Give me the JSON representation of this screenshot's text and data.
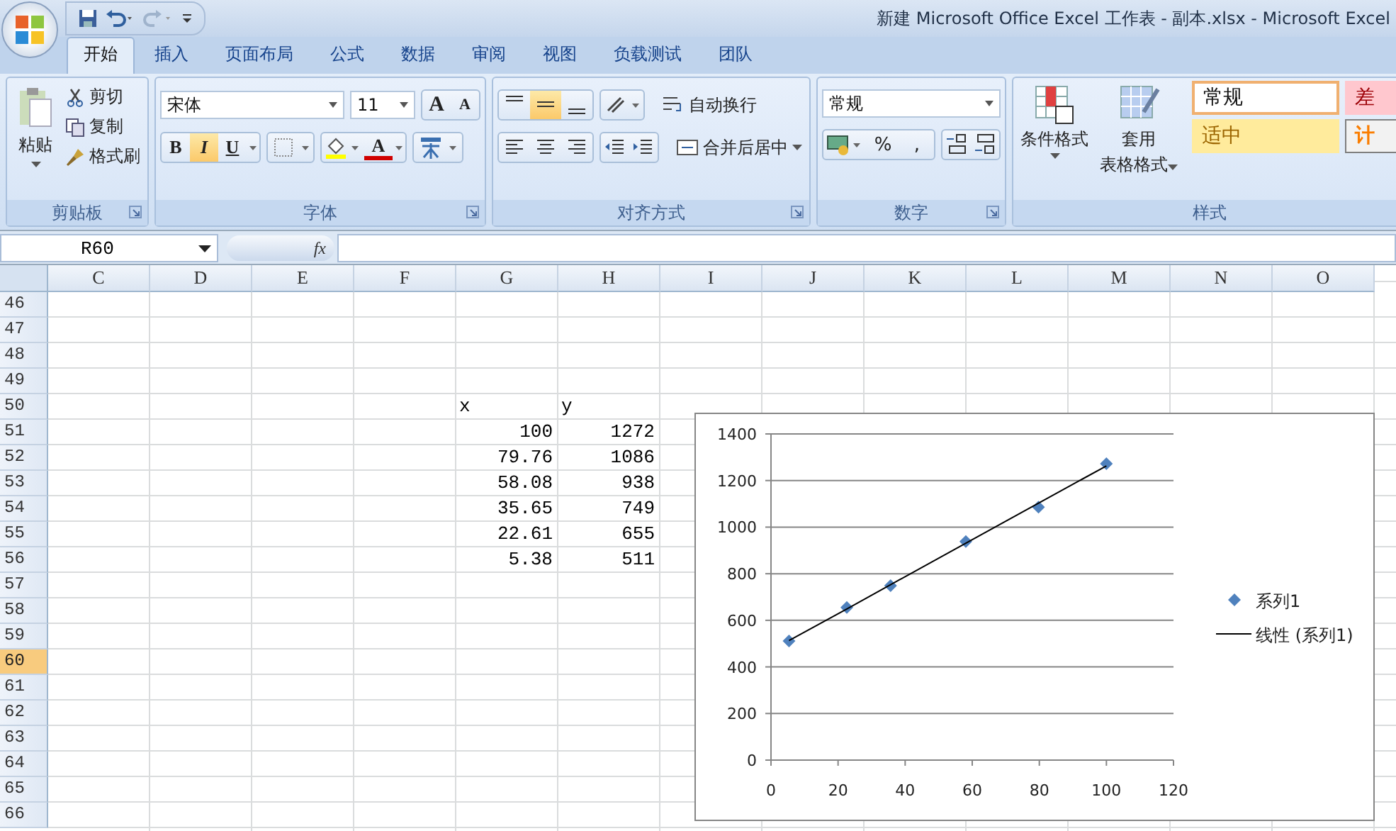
{
  "window": {
    "title": "新建 Microsoft Office Excel 工作表 - 副本.xlsx - Microsoft Excel"
  },
  "tabs": [
    {
      "label": "开始",
      "selected": true
    },
    {
      "label": "插入",
      "selected": false
    },
    {
      "label": "页面布局",
      "selected": false
    },
    {
      "label": "公式",
      "selected": false
    },
    {
      "label": "数据",
      "selected": false
    },
    {
      "label": "审阅",
      "selected": false
    },
    {
      "label": "视图",
      "selected": false
    },
    {
      "label": "负载测试",
      "selected": false
    },
    {
      "label": "团队",
      "selected": false
    }
  ],
  "clipboard": {
    "label": "剪贴板",
    "paste": "粘贴",
    "actions": [
      {
        "label": "剪切",
        "kind": "cut"
      },
      {
        "label": "复制",
        "kind": "copy"
      },
      {
        "label": "格式刷",
        "kind": "brush"
      }
    ]
  },
  "font": {
    "label": "字体",
    "name": "宋体",
    "size": "11",
    "size_buttons": [
      "A",
      "A"
    ],
    "styles": [
      {
        "label": "B",
        "kind": "bold",
        "selected": false
      },
      {
        "label": "I",
        "kind": "italic",
        "selected": true
      },
      {
        "label": "U",
        "kind": "underline",
        "selected": false
      }
    ],
    "color_letter": "A"
  },
  "alignment": {
    "label": "对齐方式",
    "vertical": [
      {
        "kind": "top",
        "selected": false
      },
      {
        "kind": "middle",
        "selected": true
      },
      {
        "kind": "bottom",
        "selected": false
      }
    ],
    "wrap": "自动换行",
    "merge": "合并后居中"
  },
  "number": {
    "label": "数字",
    "format": "常规",
    "symbols": [
      "%",
      ","
    ]
  },
  "styles": {
    "label": "样式",
    "conditional": "条件格式",
    "table": [
      "套用",
      "表格格式"
    ],
    "cells": [
      {
        "label": "常规",
        "kind": "normal"
      },
      {
        "label": "差",
        "kind": "bad"
      },
      {
        "label": "适中",
        "kind": "neutral"
      },
      {
        "label": "计",
        "kind": "calc"
      }
    ]
  },
  "formula_bar": {
    "name_box": "R60",
    "fx": "fx"
  },
  "sheet": {
    "columns": [
      "C",
      "D",
      "E",
      "F",
      "G",
      "H",
      "I",
      "J",
      "K",
      "L",
      "M",
      "N",
      "O"
    ],
    "rows": [
      {
        "number": "46",
        "selected": false
      },
      {
        "number": "47",
        "selected": false
      },
      {
        "number": "48",
        "selected": false
      },
      {
        "number": "49",
        "selected": false
      },
      {
        "number": "50",
        "selected": false,
        "kind": "labels",
        "g": "x",
        "h": "y"
      },
      {
        "number": "51",
        "selected": false,
        "g": "100",
        "h": "1272"
      },
      {
        "number": "52",
        "selected": false,
        "g": "79.76",
        "h": "1086"
      },
      {
        "number": "53",
        "selected": false,
        "g": "58.08",
        "h": "938"
      },
      {
        "number": "54",
        "selected": false,
        "g": "35.65",
        "h": "749"
      },
      {
        "number": "55",
        "selected": false,
        "g": "22.61",
        "h": "655"
      },
      {
        "number": "56",
        "selected": false,
        "g": "5.38",
        "h": "511"
      },
      {
        "number": "57",
        "selected": false
      },
      {
        "number": "58",
        "selected": false
      },
      {
        "number": "59",
        "selected": false
      },
      {
        "number": "60",
        "selected": true
      },
      {
        "number": "61",
        "selected": false
      },
      {
        "number": "62",
        "selected": false
      },
      {
        "number": "63",
        "selected": false
      },
      {
        "number": "64",
        "selected": false
      },
      {
        "number": "65",
        "selected": false
      },
      {
        "number": "66",
        "selected": false
      }
    ]
  },
  "chart": {
    "chart_data": {
      "type": "scatter",
      "x": [
        100,
        79.76,
        58.08,
        35.65,
        22.61,
        5.38
      ],
      "series": [
        {
          "name": "系列1",
          "color": "#4f81bd",
          "values": [
            1272,
            1086,
            938,
            749,
            655,
            511
          ]
        },
        {
          "name": "线性 (系列1)",
          "color": "#000000",
          "type": "line",
          "values": [
            1263,
            1103,
            931,
            753,
            649,
            513
          ]
        }
      ],
      "grid": true,
      "legend": "right",
      "xlim": [
        0,
        120
      ],
      "ylim": [
        0,
        1400
      ],
      "xticks": [
        0,
        20,
        40,
        60,
        80,
        100,
        120
      ],
      "yticks": [
        0,
        200,
        400,
        600,
        800,
        1000,
        1200,
        1400
      ]
    }
  }
}
